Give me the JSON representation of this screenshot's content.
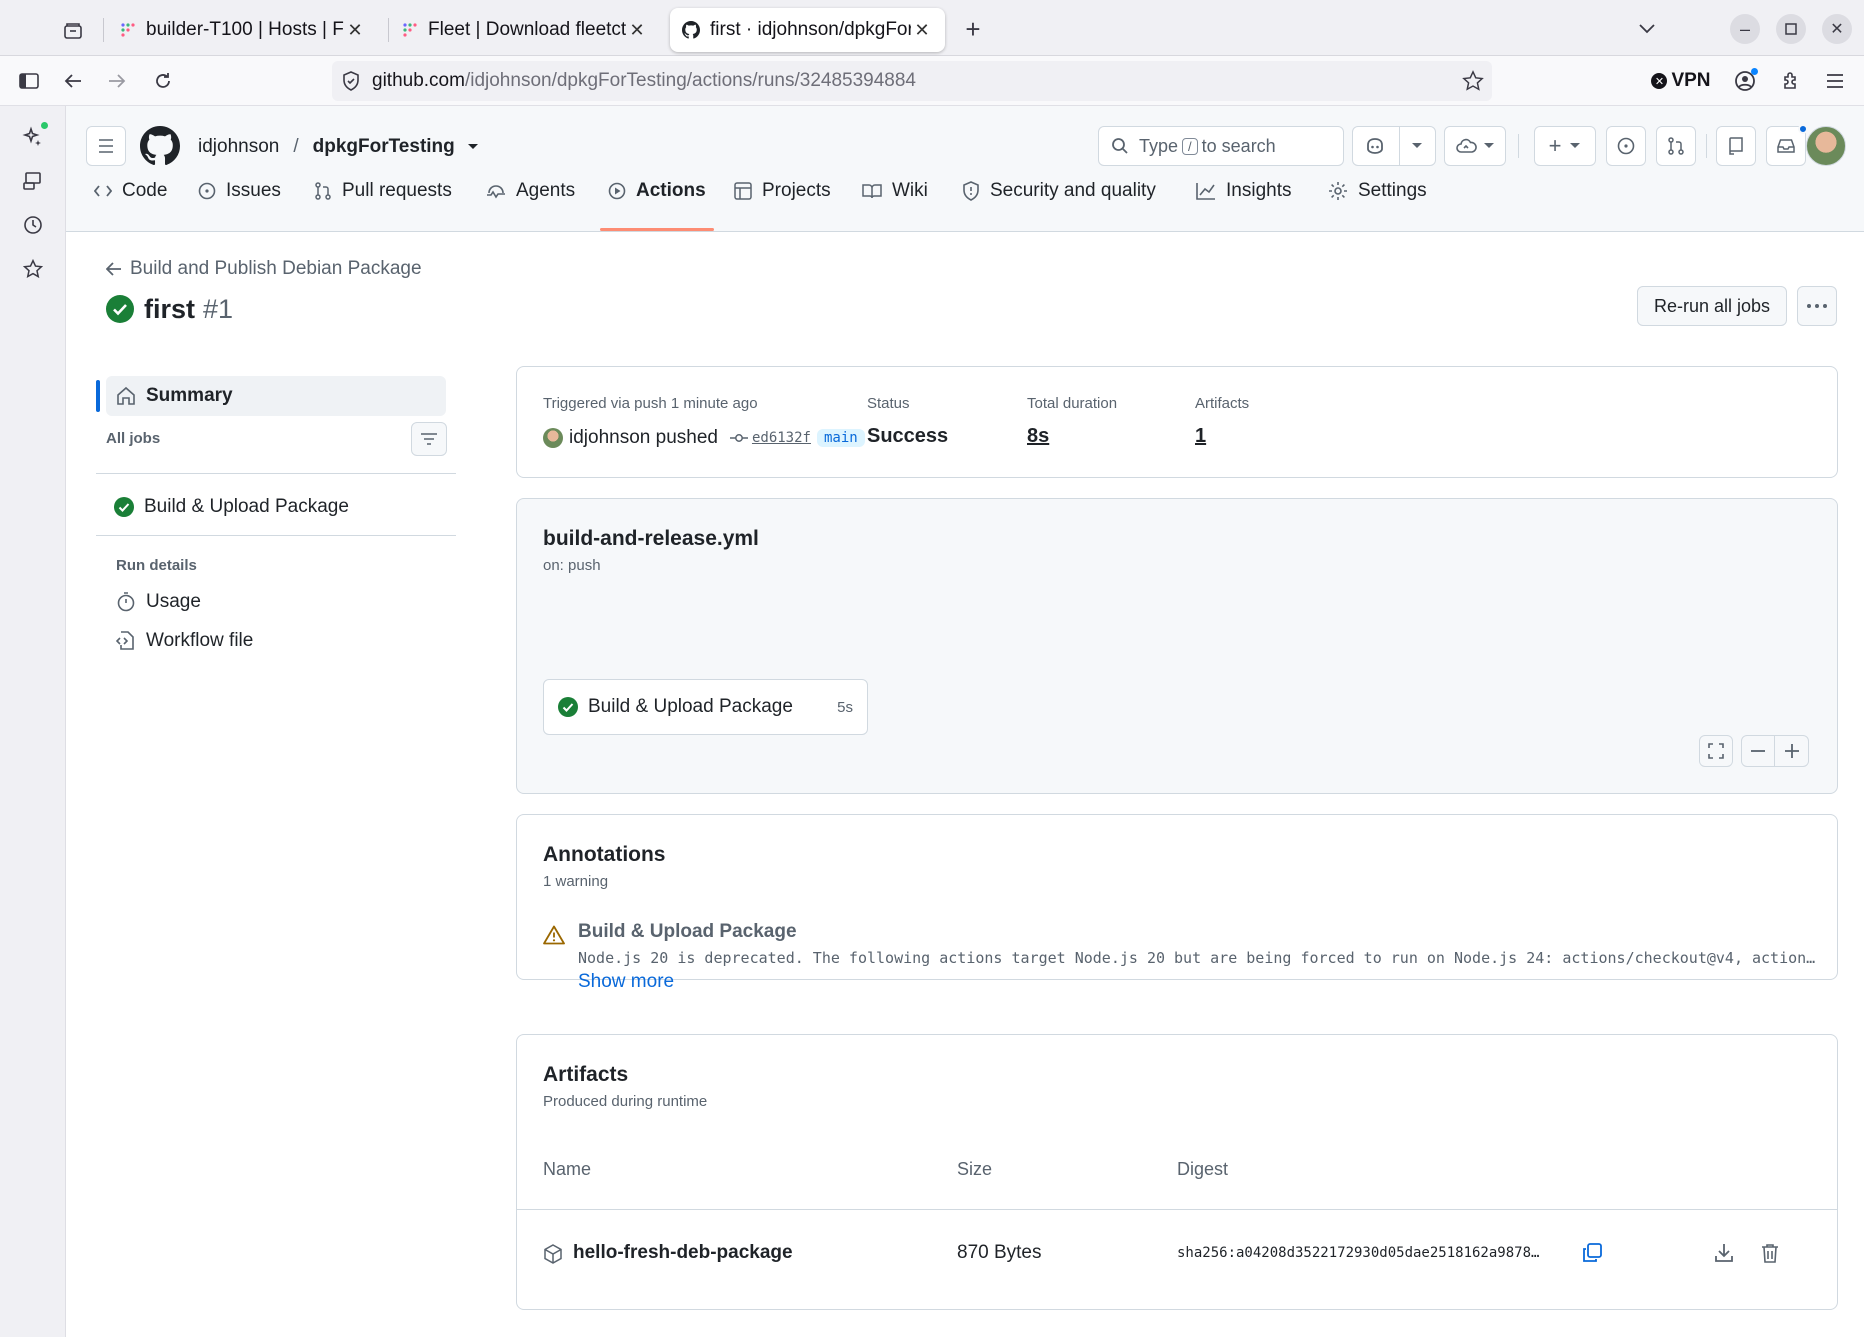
{
  "browser": {
    "tabs": [
      {
        "title": "builder-T100 | Hosts | Flee"
      },
      {
        "title": "Fleet | Download fleetctl"
      },
      {
        "title": "first · idjohnson/dpkgForT"
      }
    ],
    "url_host": "github.com",
    "url_path": "/idjohnson/dpkgForTesting/actions/runs/32485394884",
    "vpn_label": "VPN"
  },
  "header": {
    "owner": "idjohnson",
    "separator": "/",
    "repo": "dpkgForTesting",
    "search_prefix": "Type",
    "search_key": "/",
    "search_suffix": "to search"
  },
  "repo_nav": {
    "items": [
      {
        "label": "Code"
      },
      {
        "label": "Issues"
      },
      {
        "label": "Pull requests"
      },
      {
        "label": "Agents"
      },
      {
        "label": "Actions"
      },
      {
        "label": "Projects"
      },
      {
        "label": "Wiki"
      },
      {
        "label": "Security and quality"
      },
      {
        "label": "Insights"
      },
      {
        "label": "Settings"
      }
    ]
  },
  "run": {
    "back_label": "Build and Publish Debian Package",
    "title": "first",
    "number": "#1",
    "rerun_label": "Re-run all jobs"
  },
  "sidebar": {
    "summary_label": "Summary",
    "all_jobs_label": "All jobs",
    "job_label": "Build & Upload Package",
    "run_details_label": "Run details",
    "usage_label": "Usage",
    "workflow_file_label": "Workflow file"
  },
  "summary": {
    "triggered_label": "Triggered via push 1 minute ago",
    "actor": "idjohnson pushed",
    "commit": "ed6132f",
    "branch": "main",
    "status_label": "Status",
    "status_value": "Success",
    "duration_label": "Total duration",
    "duration_value": "8s",
    "artifacts_label": "Artifacts",
    "artifacts_value": "1"
  },
  "workflow": {
    "file": "build-and-release.yml",
    "trigger": "on: push",
    "job_label": "Build & Upload Package",
    "job_duration": "5s"
  },
  "annotations": {
    "title": "Annotations",
    "subtitle": "1 warning",
    "item_title": "Build & Upload Package",
    "item_message": "Node.js 20 is deprecated. The following actions target Node.js 20 but are being forced to run on Node.js 24: actions/checkout@v4, action…",
    "show_more": "Show more"
  },
  "artifacts": {
    "title": "Artifacts",
    "subtitle": "Produced during runtime",
    "col_name": "Name",
    "col_size": "Size",
    "col_digest": "Digest",
    "rows": [
      {
        "name": "hello-fresh-deb-package",
        "size": "870 Bytes",
        "digest": "sha256:a04208d3522172930d05dae2518162a9878…"
      }
    ]
  },
  "colors": {
    "success": "#1a7f37",
    "accent": "#fd8c73",
    "link": "#0969da",
    "warning": "#9a6700"
  }
}
